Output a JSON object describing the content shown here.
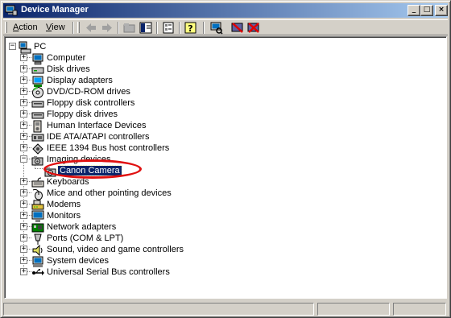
{
  "window": {
    "title": "Device Manager",
    "controls": {
      "minimize": "_",
      "maximize": "□",
      "close": "×"
    }
  },
  "menubar": {
    "items": [
      {
        "label": "Action",
        "accel": "A",
        "rest": "ction"
      },
      {
        "label": "View",
        "accel": "V",
        "rest": "iew"
      }
    ]
  },
  "toolbar": {
    "buttons": [
      "back-arrow-icon",
      "forward-arrow-icon",
      "up-folder-icon",
      "show-hide-tree-icon",
      "properties-icon",
      "help-icon",
      "scan-hardware-icon",
      "disable-device-icon",
      "uninstall-device-icon"
    ]
  },
  "tree": {
    "root": "PC",
    "categories": [
      {
        "label": "Computer",
        "icon": "computer-icon",
        "expanded": false
      },
      {
        "label": "Disk drives",
        "icon": "disk-drive-icon",
        "expanded": false
      },
      {
        "label": "Display adapters",
        "icon": "display-adapter-icon",
        "expanded": false
      },
      {
        "label": "DVD/CD-ROM drives",
        "icon": "cdrom-icon",
        "expanded": false
      },
      {
        "label": "Floppy disk controllers",
        "icon": "floppy-controller-icon",
        "expanded": false
      },
      {
        "label": "Floppy disk drives",
        "icon": "floppy-drive-icon",
        "expanded": false
      },
      {
        "label": "Human Interface Devices",
        "icon": "hid-icon",
        "expanded": false
      },
      {
        "label": "IDE ATA/ATAPI controllers",
        "icon": "ide-controller-icon",
        "expanded": false
      },
      {
        "label": "IEEE 1394 Bus host controllers",
        "icon": "ieee1394-icon",
        "expanded": false
      },
      {
        "label": "Imaging devices",
        "icon": "imaging-device-icon",
        "expanded": true,
        "children": [
          {
            "label": "Canon Camera",
            "icon": "camera-icon",
            "selected": true
          }
        ]
      },
      {
        "label": "Keyboards",
        "icon": "keyboard-icon",
        "expanded": false
      },
      {
        "label": "Mice and other pointing devices",
        "icon": "mouse-icon",
        "expanded": false
      },
      {
        "label": "Modems",
        "icon": "modem-icon",
        "expanded": false
      },
      {
        "label": "Monitors",
        "icon": "monitor-icon",
        "expanded": false
      },
      {
        "label": "Network adapters",
        "icon": "network-adapter-icon",
        "expanded": false
      },
      {
        "label": "Ports (COM & LPT)",
        "icon": "port-icon",
        "expanded": false
      },
      {
        "label": "Sound, video and game controllers",
        "icon": "sound-icon",
        "expanded": false
      },
      {
        "label": "System devices",
        "icon": "system-device-icon",
        "expanded": false
      },
      {
        "label": "Universal Serial Bus controllers",
        "icon": "usb-icon",
        "expanded": false
      }
    ]
  },
  "colors": {
    "title_gradient_start": "#0a246a",
    "title_gradient_end": "#a6caf0",
    "selection": "#0a246a",
    "annotation_ellipse": "#e01010"
  }
}
